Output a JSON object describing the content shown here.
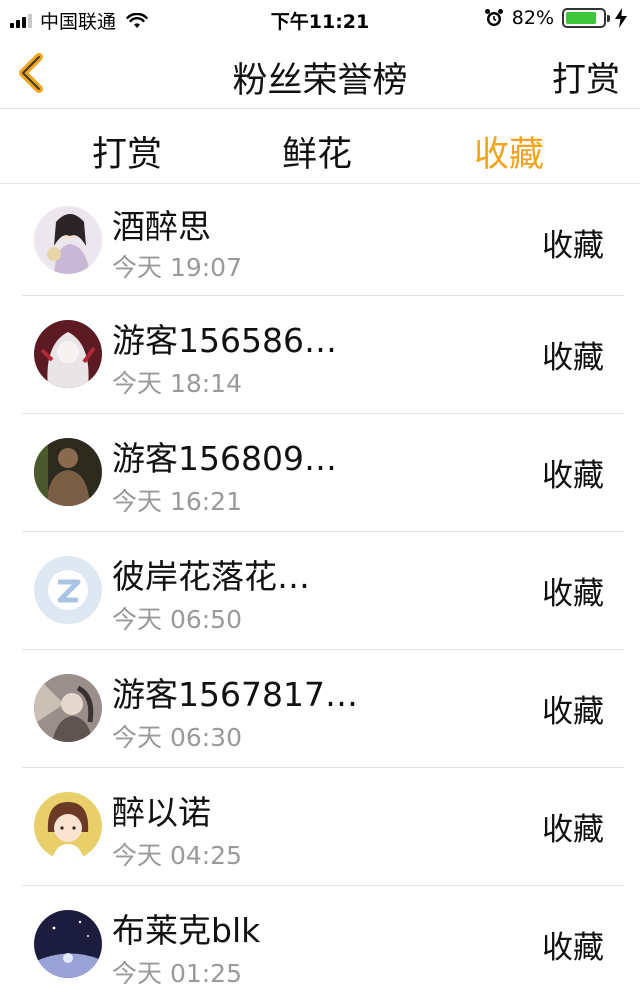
{
  "status_bar": {
    "carrier": "中国联通",
    "time": "下午11:21",
    "battery_percent": "82%",
    "battery_level": 0.82,
    "icons": [
      "signal-icon",
      "wifi-icon",
      "alarm-icon",
      "battery-icon",
      "charging-icon"
    ]
  },
  "nav": {
    "back_icon": "chevron-left-icon",
    "title": "粉丝荣誉榜",
    "action": "打赏"
  },
  "tabs": [
    {
      "label": "打赏",
      "active": false
    },
    {
      "label": "鲜花",
      "active": false
    },
    {
      "label": "收藏",
      "active": true
    }
  ],
  "colors": {
    "accent": "#f2a51c",
    "battery": "#3ec63a",
    "secondary_text": "#9a9a9a"
  },
  "items": [
    {
      "name": "酒醉思",
      "time": "今天 19:07",
      "action": "收藏",
      "avatar": "avatar-ancient-girl"
    },
    {
      "name": "游客156586…",
      "time": "今天 18:14",
      "action": "收藏",
      "avatar": "avatar-white-hair"
    },
    {
      "name": "游客156809…",
      "time": "今天 16:21",
      "action": "收藏",
      "avatar": "avatar-man-photo"
    },
    {
      "name": "彼岸花落花…",
      "time": "今天 06:50",
      "action": "收藏",
      "avatar": "avatar-qq-default"
    },
    {
      "name": "游客1567817…",
      "time": "今天 06:30",
      "action": "收藏",
      "avatar": "avatar-fantasy-woman"
    },
    {
      "name": "醉以诺",
      "time": "今天 04:25",
      "action": "收藏",
      "avatar": "avatar-cartoon-girl"
    },
    {
      "name": "布莱克blk",
      "time": "今天 01:25",
      "action": "收藏",
      "avatar": "avatar-night-sky"
    }
  ]
}
